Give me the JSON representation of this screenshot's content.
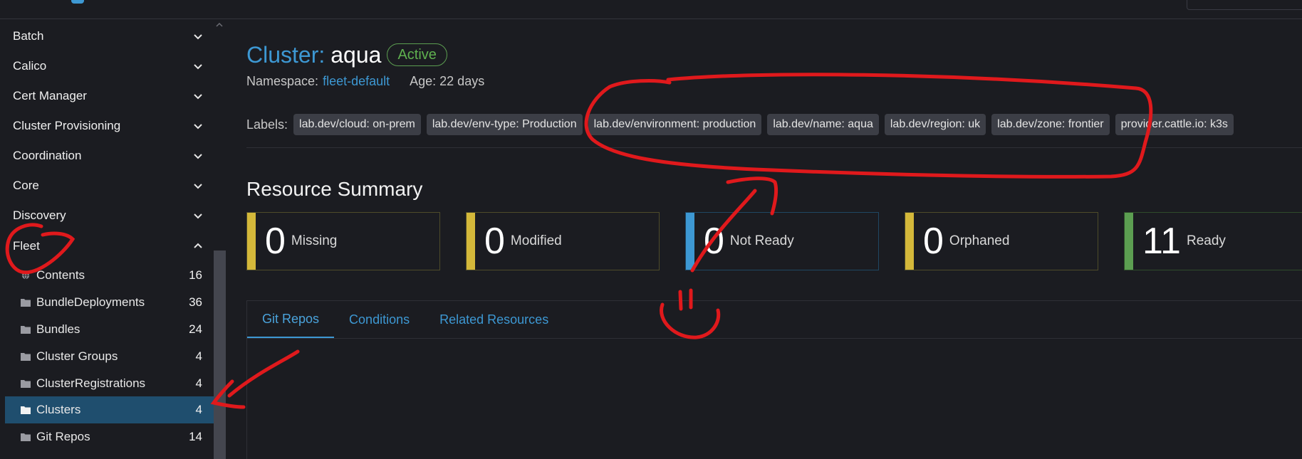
{
  "sidebar": {
    "groups": [
      {
        "label": "Batch"
      },
      {
        "label": "Calico"
      },
      {
        "label": "Cert Manager"
      },
      {
        "label": "Cluster Provisioning"
      },
      {
        "label": "Coordination"
      },
      {
        "label": "Core"
      },
      {
        "label": "Discovery"
      },
      {
        "label": "Fleet"
      }
    ],
    "fleet_items": [
      {
        "label": "Contents",
        "count": "16",
        "icon": "globe-icon"
      },
      {
        "label": "BundleDeployments",
        "count": "36",
        "icon": "folder-icon"
      },
      {
        "label": "Bundles",
        "count": "24",
        "icon": "folder-icon"
      },
      {
        "label": "Cluster Groups",
        "count": "4",
        "icon": "folder-icon"
      },
      {
        "label": "ClusterRegistrations",
        "count": "4",
        "icon": "folder-icon"
      },
      {
        "label": "Clusters",
        "count": "4",
        "icon": "folder-icon",
        "active": true
      },
      {
        "label": "Git Repos",
        "count": "14",
        "icon": "folder-icon"
      }
    ]
  },
  "detail": {
    "title_prefix": "Cluster:",
    "name": "aqua",
    "state": "Active",
    "namespace_label": "Namespace:",
    "namespace": "fleet-default",
    "age": "Age: 22 days",
    "labels_caption": "Labels:",
    "labels": [
      "lab.dev/cloud: on-prem",
      "lab.dev/env-type: Production",
      "lab.dev/environment: production",
      "lab.dev/name: aqua",
      "lab.dev/region: uk",
      "lab.dev/zone: frontier",
      "provider.cattle.io: k3s"
    ]
  },
  "resource_summary": {
    "title": "Resource Summary",
    "cards": [
      {
        "count": "0",
        "label": "Missing",
        "color": "#d4b83a"
      },
      {
        "count": "0",
        "label": "Modified",
        "color": "#d4b83a"
      },
      {
        "count": "0",
        "label": "Not Ready",
        "color": "#3d98d3"
      },
      {
        "count": "0",
        "label": "Orphaned",
        "color": "#d4b83a"
      },
      {
        "count": "11",
        "label": "Ready",
        "color": "#5c9e51"
      }
    ]
  },
  "tabs": [
    {
      "label": "Git Repos",
      "active": true
    },
    {
      "label": "Conditions"
    },
    {
      "label": "Related Resources"
    }
  ],
  "colors": {
    "accent": "#3d98d3",
    "annotation": "#e0191c",
    "success": "#5fb04f",
    "warning": "#d4b83a"
  }
}
